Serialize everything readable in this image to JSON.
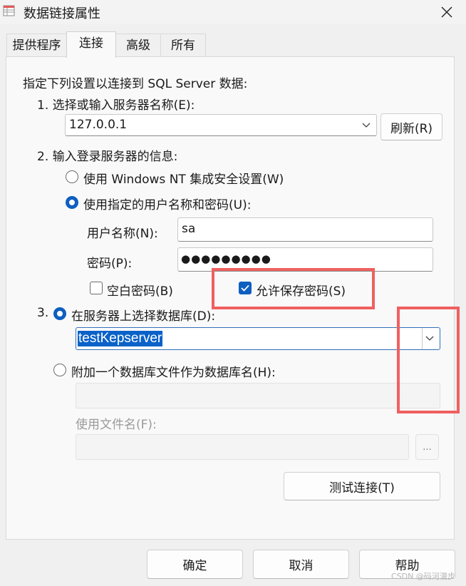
{
  "window": {
    "title": "数据链接属性",
    "close_icon": "close-icon"
  },
  "tabs": [
    {
      "label": "提供程序",
      "active": false
    },
    {
      "label": "连接",
      "active": true
    },
    {
      "label": "高级",
      "active": false
    },
    {
      "label": "所有",
      "active": false
    }
  ],
  "connection": {
    "intro": "指定下列设置以连接到 SQL Server 数据:",
    "step1_label": "1. 选择或输入服务器名称(E):",
    "server_value": "127.0.0.1",
    "refresh_label": "刷新(R)",
    "step2_label": "2. 输入登录服务器的信息:",
    "auth_windows_label": "使用 Windows NT 集成安全设置(W)",
    "auth_sql_label": "使用指定的用户名称和密码(U):",
    "auth_selected": "sql",
    "username_label": "用户名称(N):",
    "username_value": "sa",
    "password_label": "密码(P):",
    "password_value": "●●●●●●●●●",
    "blank_password_label": "空白密码(B)",
    "blank_password_checked": false,
    "allow_save_label": "允许保存密码(S)",
    "allow_save_checked": true,
    "step3_number": "3.",
    "select_db_label": "在服务器上选择数据库(D):",
    "database_value": "testKepserver",
    "attach_db_label": "附加一个数据库文件作为数据库名(H):",
    "attach_db_value": "",
    "filename_label": "使用文件名(F):",
    "filename_value": "",
    "browse_label": "...",
    "test_button_label": "测试连接(T)"
  },
  "footer": {
    "ok_label": "确定",
    "cancel_label": "取消",
    "help_label": "帮助"
  },
  "watermark": "CSDN @码河漫步",
  "colors": {
    "accent": "#0e5fbf",
    "highlight": "#f06060",
    "selection": "#0a62c8"
  }
}
